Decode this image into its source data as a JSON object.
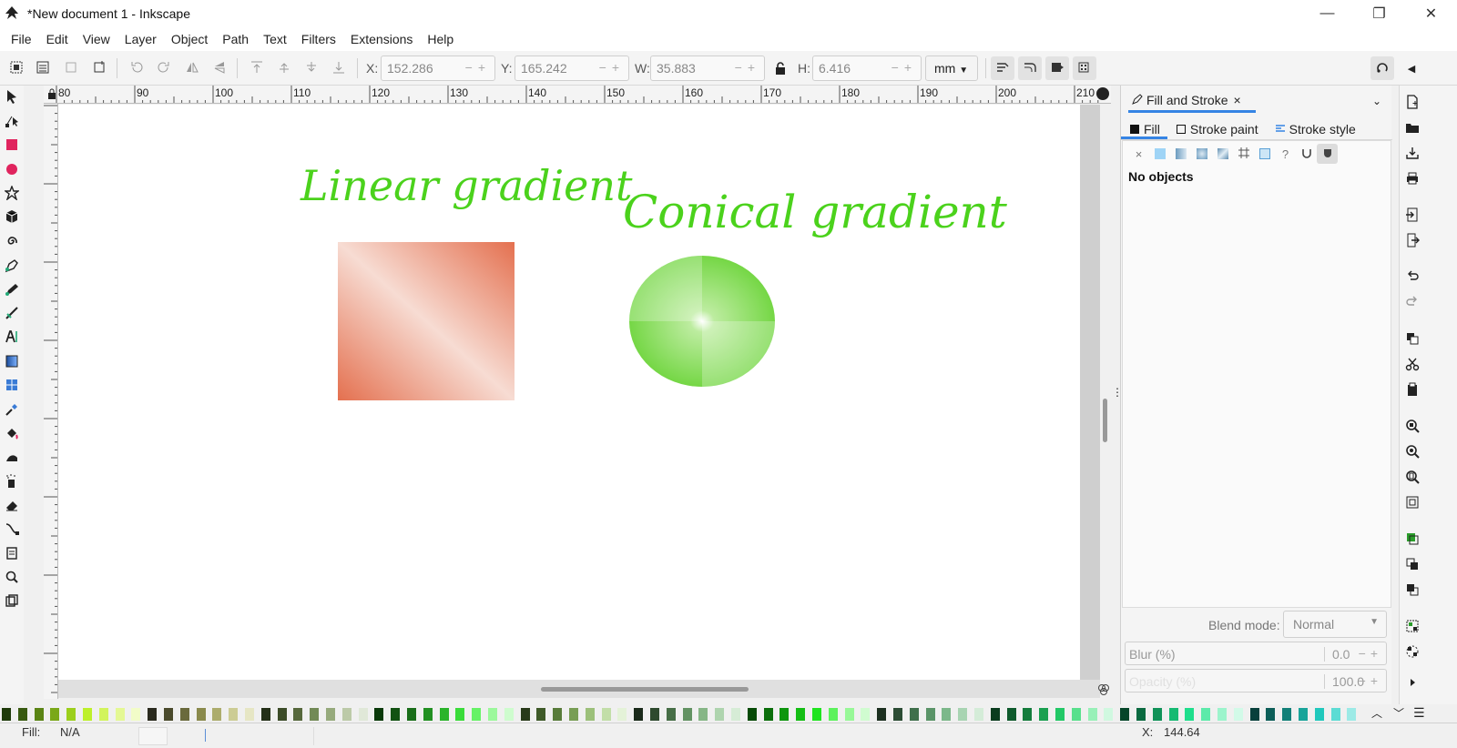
{
  "window": {
    "title": "*New document 1 - Inkscape",
    "minimize": "—",
    "maximize": "❐",
    "close": "✕"
  },
  "menu": [
    "File",
    "Edit",
    "View",
    "Layer",
    "Object",
    "Path",
    "Text",
    "Filters",
    "Extensions",
    "Help"
  ],
  "toolbar": {
    "x_label": "X:",
    "x_value": "152.286",
    "y_label": "Y:",
    "y_value": "165.242",
    "w_label": "W:",
    "w_value": "35.883",
    "h_label": "H:",
    "h_value": "6.416",
    "unit": "mm",
    "spin_controls": "−+"
  },
  "ruler": {
    "h_ticks": [
      "80",
      "90",
      "100",
      "110",
      "120",
      "130",
      "140",
      "150",
      "160",
      "170",
      "180",
      "190",
      "200",
      "210"
    ]
  },
  "canvas": {
    "linear_text": "Linear gradient",
    "conical_text": "Conical gradient",
    "text_color": "#4bd21c",
    "linear_color_a": "#e4704f",
    "conical_color": "#6cd43a"
  },
  "dock": {
    "tab_title": "Fill and Stroke",
    "tab_close": "×",
    "subtabs": [
      "Fill",
      "Stroke paint",
      "Stroke style"
    ],
    "paint_none": "×",
    "paint_unknown": "?",
    "no_objects": "No objects",
    "blend_label": "Blend mode:",
    "blend_value": "Normal",
    "blur_label": "Blur (%)",
    "blur_value": "0.0",
    "opacity_label": "Opacity (%)",
    "opacity_value": "100.0",
    "spin_controls": "−+"
  },
  "status": {
    "fill_label": "Fill:",
    "fill_value": "N/A",
    "x_coord_label": "X:",
    "x_coord_value": "144.64"
  },
  "palette": {
    "colors": [
      "#1e3a0a",
      "#385a10",
      "#5a8414",
      "#7aa818",
      "#9ccf1c",
      "#bdf02a",
      "#d2f45c",
      "#e4f894",
      "#f2fcc8",
      "#2a2a1e",
      "#4a4a2c",
      "#6a6a3c",
      "#8a8a4c",
      "#acac6c",
      "#cccc94",
      "#e6e6c4",
      "#243018",
      "#3c4c28",
      "#56683c",
      "#728a56",
      "#96aa7c",
      "#bccaa8",
      "#e0e8d8",
      "#0a3a0a",
      "#125212",
      "#1a6e1a",
      "#229022",
      "#2ab42a",
      "#3adc3a",
      "#66f266",
      "#9cf89c",
      "#cefcce",
      "#283a1a",
      "#3e5a28",
      "#587c3a",
      "#789e54",
      "#9cc07a",
      "#c2dea8",
      "#e4f2d8",
      "#1a2a1a",
      "#2e4a2e",
      "#466e46",
      "#629262",
      "#86b686",
      "#aed4ae",
      "#d6ecd6",
      "#064a06",
      "#0a6e0a",
      "#0e960e",
      "#14be14",
      "#20e420",
      "#5cf25c",
      "#98f898",
      "#d0fcd0",
      "#1c3020",
      "#2c4c34",
      "#40704c",
      "#5a9468",
      "#7cb88a",
      "#a8d4b2",
      "#d4ecd8",
      "#0a3c1e",
      "#0e5a2c",
      "#147c3c",
      "#1aa050",
      "#22c866",
      "#58e08c",
      "#98f0b8",
      "#d0f8e0",
      "#06462a",
      "#0a6a40",
      "#109258",
      "#16ba72",
      "#1ede8c",
      "#5ceaaa",
      "#9cf4cc",
      "#d2fae8",
      "#08403c",
      "#0c5e58",
      "#128078",
      "#18a49a",
      "#20c8bc",
      "#5cdcd4",
      "#9ceae6"
    ]
  }
}
